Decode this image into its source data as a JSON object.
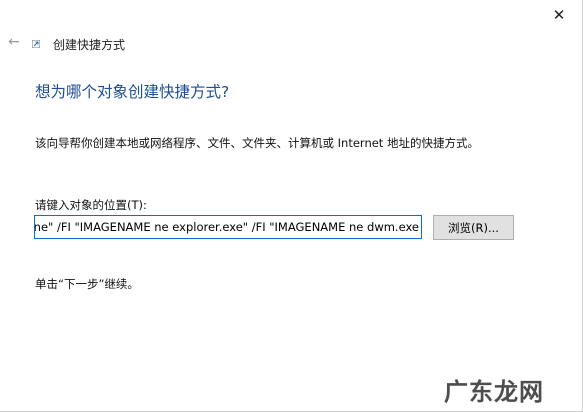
{
  "window": {
    "close_glyph": "✕",
    "back_glyph": "←",
    "title": "创建快捷方式"
  },
  "main": {
    "heading": "想为哪个对象创建快捷方式?",
    "description": "该向导帮你创建本地或网络程序、文件、文件夹、计算机或 Internet 地址的快捷方式。",
    "location_label": "请键入对象的位置(T):",
    "location_value": "ne\" /FI \"IMAGENAME ne explorer.exe\" /FI \"IMAGENAME ne dwm.exe",
    "browse_label": "浏览(R)...",
    "hint": "单击“下一步”继续。"
  },
  "watermark": "广东龙网",
  "colors": {
    "heading": "#1f4e91",
    "input_border": "#0a6cd6"
  },
  "icons": [
    "close-icon",
    "back-arrow-icon",
    "shortcut-wizard-icon"
  ]
}
